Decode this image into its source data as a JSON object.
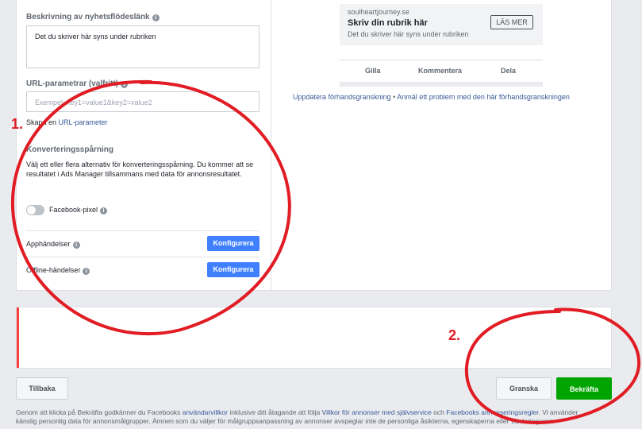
{
  "form": {
    "desc_label": "Beskrivning av nyhetsflödeslänk",
    "desc_value": "Det du skriver här syns under rubriken",
    "url_label": "URL-parametrar (valfritt)",
    "url_placeholder": "Exempel: key1=value1&key2=value2",
    "url_link_prefix": "Skapa en ",
    "url_link_text": "URL-parameter",
    "conv_label": "Konverteringsspårning",
    "conv_desc": "Välj ett eller flera alternativ för konverteringsspårning. Du kommer att se resultatet i Ads Manager tillsammans med data för annonsresultatet.",
    "pixel_label": "Facebook-pixel",
    "pixel_on": false,
    "app_events_label": "Apphändelser",
    "offline_events_label": "Offline-händelser",
    "configure_label": "Konfigurera"
  },
  "preview": {
    "domain": "soulheartjourney.se",
    "headline": "Skriv din rubrik här",
    "description": "Det du skriver här syns under rubriken",
    "cta": "LÄS MER",
    "actions": [
      "Gilla",
      "Kommentera",
      "Dela"
    ],
    "update_link": "Uppdatera förhandsgranskning",
    "separator": "•",
    "report_link": "Anmäl ett problem med den här förhandsgranskningen"
  },
  "buttons": {
    "back": "Tillbaka",
    "review": "Granska",
    "confirm": "Bekräfta"
  },
  "footer": {
    "t1": "Genom att klicka på Bekräfta godkänner du Facebooks ",
    "l1": "användarvillkor",
    "t2": " inklusive ditt åtagande att följa ",
    "l2": "Villkor för annonser med självservice",
    "t3": " och ",
    "l3": "Facebooks annonseringsregler",
    "t4": ". Vi använder ",
    "t5": "känslig personlig data för annonsmålgrupper. Ämnen som du väljer för målgruppsanpassning av annonser avspeglar inte de personliga åsikterna, egenskaperna eller värderingarna."
  },
  "annotations": {
    "mark1": "1.",
    "mark2": "2.",
    "color": "#e11c24"
  },
  "colors": {
    "accent": "#4080ff",
    "confirm": "#00a400",
    "link": "#385898",
    "error": "#fa3e3e"
  }
}
